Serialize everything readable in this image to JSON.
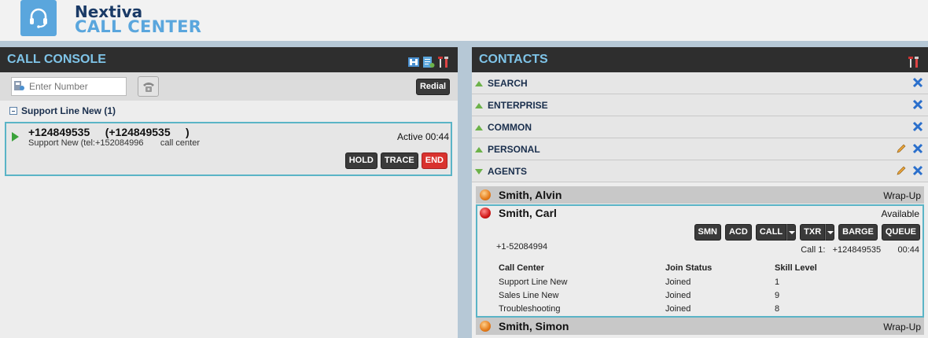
{
  "brand": {
    "line1": "Nextiva",
    "line2": "CALL CENTER",
    "logo_icon": "headset-icon",
    "color_primary": "#5aa6dd",
    "color_dark": "#1a3a66"
  },
  "call_console": {
    "title": "CALL CONSOLE",
    "header_icons": [
      "conference-icon",
      "notes-icon",
      "tools-icon"
    ],
    "number_placeholder": "Enter Number",
    "redial_label": "Redial",
    "group": {
      "label": "Support Line New (1)"
    },
    "call": {
      "number": "+124849535     (+124849535     )",
      "detail": "Support New (tel:+152084996       call center",
      "status": "Active 00:44",
      "buttons": {
        "hold": "HOLD",
        "trace": "TRACE",
        "end": "END"
      }
    }
  },
  "contacts": {
    "title": "CONTACTS",
    "sections": [
      {
        "label": "SEARCH"
      },
      {
        "label": "ENTERPRISE"
      },
      {
        "label": "COMMON"
      },
      {
        "label": "PERSONAL"
      },
      {
        "label": "AGENTS"
      }
    ],
    "agents": [
      {
        "name": "Smith, Alvin",
        "state": "Wrap-Up"
      },
      {
        "name": "Smith, Carl",
        "state": "Available"
      },
      {
        "name": "Smith, Simon",
        "state": "Wrap-Up"
      }
    ],
    "selected_agent": {
      "buttons": {
        "smn": "SMN",
        "acd": "ACD",
        "call": "CALL",
        "txr": "TXR",
        "barge": "BARGE",
        "queue": "QUEUE"
      },
      "phone": "+1-52084994",
      "call_info": "Call 1:   +124849535       00:44",
      "table": {
        "headers": [
          "Call Center",
          "Join Status",
          "Skill Level"
        ],
        "rows": [
          [
            "Support Line New",
            "Joined",
            "1"
          ],
          [
            "Sales Line New",
            "Joined",
            "9"
          ],
          [
            "Troubleshooting",
            "Joined",
            "8"
          ]
        ]
      }
    }
  }
}
